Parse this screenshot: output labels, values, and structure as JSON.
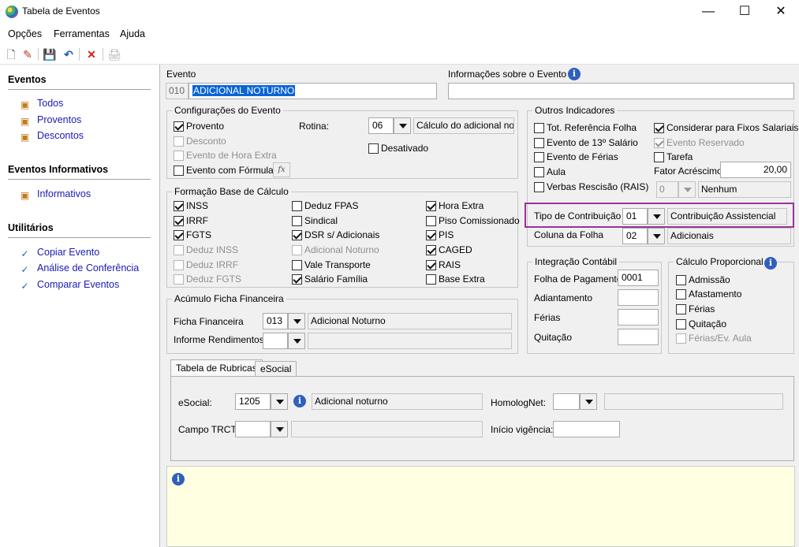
{
  "window": {
    "title": "Tabela de Eventos",
    "minimize": "—",
    "maximize": "☐",
    "close": "✕"
  },
  "menu": [
    "Opções",
    "Ferramentas",
    "Ajuda"
  ],
  "toolbar": {
    "icons": [
      "new-icon",
      "edit-icon",
      "save-icon",
      "undo-icon",
      "delete-icon",
      "print-icon"
    ],
    "glyphs": [
      "🗋",
      "✎",
      "💾",
      "↶",
      "✕",
      "🖨"
    ]
  },
  "sidebar": {
    "eventos": {
      "title": "Eventos",
      "items": [
        "Todos",
        "Proventos",
        "Descontos"
      ]
    },
    "informativos": {
      "title": "Eventos Informativos",
      "items": [
        "Informativos"
      ]
    },
    "utilitarios": {
      "title": "Utilitários",
      "items": [
        "Copiar Evento",
        "Análise de Conferência",
        "Comparar Eventos"
      ]
    }
  },
  "evento": {
    "label": "Evento",
    "code": "010",
    "name": "ADICIONAL NOTURNO"
  },
  "info_sobre": {
    "label": "Informações sobre o Evento",
    "value": ""
  },
  "config": {
    "title": "Configurações do Evento",
    "provento": "Provento",
    "desconto": "Desconto",
    "hora_extra": "Evento de Hora Extra",
    "formula": "Evento com Fórmula",
    "fx": "fx",
    "rotina_label": "Rotina:",
    "rotina_code": "06",
    "rotina_desc": "Cálculo do adicional notu",
    "desativado": "Desativado"
  },
  "base": {
    "title": "Formação Base de Cálculo",
    "col1": [
      "INSS",
      "IRRF",
      "FGTS",
      "Deduz INSS",
      "Deduz IRRF",
      "Deduz FGTS"
    ],
    "col2": [
      "Deduz FPAS",
      "Sindical",
      "DSR s/ Adicionais",
      "Adicional Noturno",
      "Vale Transporte",
      "Salário Família"
    ],
    "col3": [
      "Hora Extra",
      "Piso Comissionado",
      "PIS",
      "CAGED",
      "RAIS",
      "Base Extra"
    ]
  },
  "acumulo": {
    "title": "Acúmulo Ficha Financeira",
    "ficha_label": "Ficha Financeira",
    "ficha_code": "013",
    "ficha_desc": "Adicional Noturno",
    "informe_label": "Informe Rendimentos",
    "informe_code": "",
    "informe_desc": ""
  },
  "outros": {
    "title": "Outros Indicadores",
    "tot_ref": "Tot. Referência Folha",
    "evento13": "Evento de 13º Salário",
    "ferias": "Evento de Férias",
    "aula": "Aula",
    "verbas": "Verbas Rescisão (RAIS)",
    "considerar": "Considerar para Fixos Salariais",
    "reservado": "Evento Reservado",
    "tarefa": "Tarefa",
    "fator_label": "Fator Acréscimo",
    "fator_value": "20,00",
    "verbas_code": "0",
    "verbas_desc": "Nenhum",
    "tipo_label": "Tipo de Contribuição",
    "tipo_code": "01",
    "tipo_desc": "Contribuição Assistencial",
    "coluna_label": "Coluna da Folha",
    "coluna_code": "02",
    "coluna_desc": "Adicionais"
  },
  "integracao": {
    "title": "Integração Contábil",
    "folha_label": "Folha de Pagamento",
    "folha_value": "0001",
    "adiant_label": "Adiantamento",
    "ferias_label": "Férias",
    "quitacao_label": "Quitação"
  },
  "proporcional": {
    "title": "Cálculo Proporcional",
    "items": [
      "Admissão",
      "Afastamento",
      "Férias",
      "Quitação",
      "Férias/Ev. Aula"
    ]
  },
  "tabs": [
    "Tabela de Rubricas",
    "eSocial"
  ],
  "rubricas": {
    "esocial_label": "eSocial:",
    "esocial_code": "1205",
    "esocial_desc": "Adicional noturno",
    "homolog_label": "HomologNet:",
    "homolog_code": "",
    "campo_label": "Campo TRCT:",
    "campo_code": "",
    "inicio_label": "Início vigência:",
    "inicio_value": ""
  },
  "info_glyph": "i",
  "check_glyph": "✓"
}
